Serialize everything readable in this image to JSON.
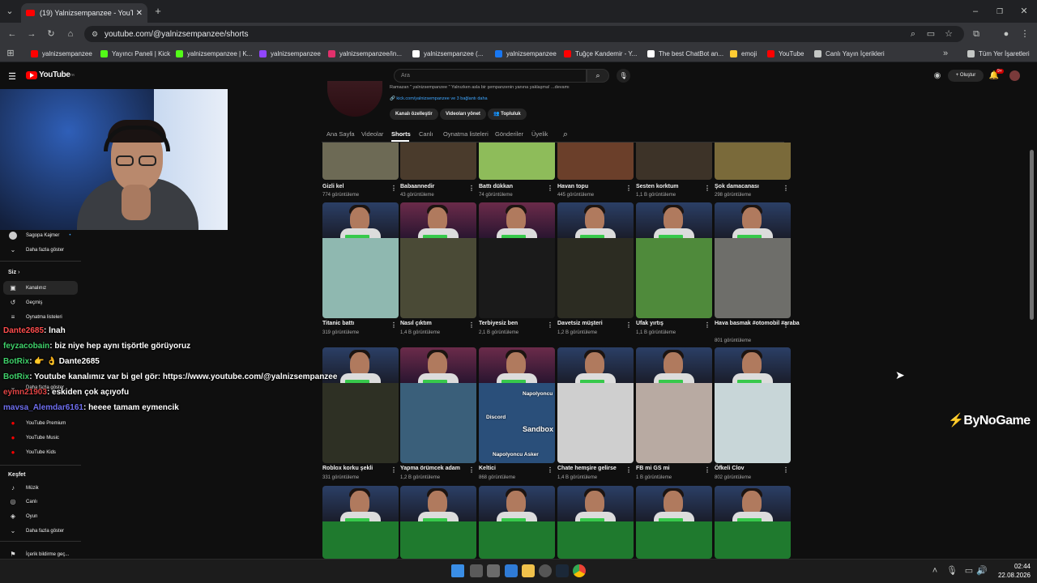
{
  "browser": {
    "tab_title": "(19) Yalnizsempanzee - YouTub",
    "url": "youtube.com/@yalnizsempanzee/shorts",
    "bookmarks": [
      {
        "label": "yalnizsempanzee",
        "color": "#ff0000"
      },
      {
        "label": "Yayıncı Paneli | Kick",
        "color": "#53fc18"
      },
      {
        "label": "yalnizsempanzee | K...",
        "color": "#53fc18"
      },
      {
        "label": "yalnizsempanzee",
        "color": "#9146ff"
      },
      {
        "label": "yalnizsempanzee/in...",
        "color": "#e1306c"
      },
      {
        "label": "yalnizsempanzee (...",
        "color": "#ffffff"
      },
      {
        "label": "yalnizsempanzee",
        "color": "#1877f2"
      },
      {
        "label": "Tuğçe Kandemir - Y...",
        "color": "#ff0000"
      },
      {
        "label": "The best ChatBot an...",
        "color": "#ffffff"
      },
      {
        "label": "emoji",
        "color": "#ffcc33"
      },
      {
        "label": "YouTube",
        "color": "#ff0000"
      },
      {
        "label": "Canlı Yayın İçerikleri",
        "color": "#c4c7c5"
      }
    ],
    "all_bookmarks": "Tüm Yer İşaretleri"
  },
  "youtube": {
    "logo": "YouTube",
    "logo_sup": "TR",
    "search_placeholder": "Ara",
    "create_label": "Oluştur",
    "notif_count": "9+"
  },
  "channel": {
    "description": "Ramazan \" yalnizsempanzee \" Yalnızken asla bir şempanzenin yanına yaklaşma! ...devamı",
    "links": "kick.com/yalnizsempanzee ve 3 bağlantı daha",
    "buttons": [
      "Kanalı özelleştir",
      "Videoları yönet",
      "Topluluk"
    ],
    "tabs": [
      "Ana Sayfa",
      "Videolar",
      "Shorts",
      "Canlı",
      "Oynatma listeleri",
      "Gönderiler",
      "Üyelik"
    ],
    "active_tab": "Shorts"
  },
  "sidebar": {
    "sub_item": "Sagopa Kajmer",
    "show_more": "Daha fazla göster",
    "you_header": "Siz",
    "you_items": [
      {
        "label": "Kanalınız",
        "icon": "person-icon",
        "selected": true
      },
      {
        "label": "Geçmiş",
        "icon": "history-icon",
        "selected": false
      },
      {
        "label": "Oynatma listeleri",
        "icon": "playlist-icon",
        "selected": false
      }
    ],
    "more_from": [
      {
        "label": "YouTube Premium"
      },
      {
        "label": "YouTube Music"
      },
      {
        "label": "YouTube Kids"
      }
    ],
    "explore_header": "Keşfet",
    "explore_items": [
      {
        "label": "Müzik",
        "icon": "music-icon"
      },
      {
        "label": "Canlı",
        "icon": "live-icon"
      },
      {
        "label": "Oyun",
        "icon": "game-icon"
      }
    ],
    "show_more2": "Daha fazla göster",
    "report": "İçerik bildirme geç..."
  },
  "shorts_rows": [
    [
      {
        "title": "Gizli kel",
        "views": "774 görüntüleme"
      },
      {
        "title": "Babaannedir",
        "views": "43 görüntüleme"
      },
      {
        "title": "Battı dükkan",
        "views": "74 görüntüleme"
      },
      {
        "title": "Havan topu",
        "views": "445 görüntüleme"
      },
      {
        "title": "Sesten korktum",
        "views": "1,1 B görüntüleme"
      },
      {
        "title": "Şok damacanası",
        "views": "298 görüntüleme"
      }
    ],
    [
      {
        "title": "Titanic battı",
        "views": "319 görüntüleme"
      },
      {
        "title": "Nasıl çıktım",
        "views": "1,4 B görüntüleme"
      },
      {
        "title": "Terbiyesiz ben",
        "views": "2,1 B görüntüleme"
      },
      {
        "title": "Davetsiz müşteri",
        "views": "1,2 B görüntüleme"
      },
      {
        "title": "Ufak yırtış",
        "views": "1,1 B görüntüleme"
      },
      {
        "title": "Hava basmak #otomobil #araba",
        "views": "801 görüntüleme"
      }
    ],
    [
      {
        "title": "Roblox korku şekli",
        "views": "331 görüntüleme"
      },
      {
        "title": "Yapma örümcek adam",
        "views": "1,2 B görüntüleme"
      },
      {
        "title": "Keltici",
        "views": "868 görüntüleme"
      },
      {
        "title": "Chate hemşire gelirse",
        "views": "1,4 B görüntüleme"
      },
      {
        "title": "FB mi GS mi",
        "views": "1 B görüntüleme"
      },
      {
        "title": "Öfkeli Clov",
        "views": "802 görüntüleme"
      }
    ]
  ],
  "thumb_text": {
    "discord": "Discord",
    "sandbox": "Sandbox",
    "napolyoncu": "Napolyoncu",
    "napolyoncu_asker": "Napolyoncu Asker"
  },
  "chat": [
    {
      "user": "Dante2685",
      "msg": ": lnah",
      "color": "#ff4d4d"
    },
    {
      "user": "feyzacobain",
      "msg": ": biz niye hep aynı tişörtle görüyoruz",
      "color": "#3fd16a"
    },
    {
      "user": "BotRix",
      "msg": ": 👉 👌 Dante2685",
      "color": "#3fd16a"
    },
    {
      "user": "BotRix",
      "msg": ": Youtube kanalımız var bi gel gör: https://www.youtube.com/@yalnizsempanzee",
      "color": "#3fd16a"
    },
    {
      "user": "eymn21903",
      "msg": ": eskiden çok açıyofu",
      "color": "#e04444"
    },
    {
      "user": "mavsa_Alemdar6161",
      "msg": ": heeee tamam eymencik",
      "color": "#6f6ff0"
    }
  ],
  "overlay_brand": "ByNoGame",
  "clock": {
    "time": "02:44",
    "date": "22.08.2026"
  }
}
